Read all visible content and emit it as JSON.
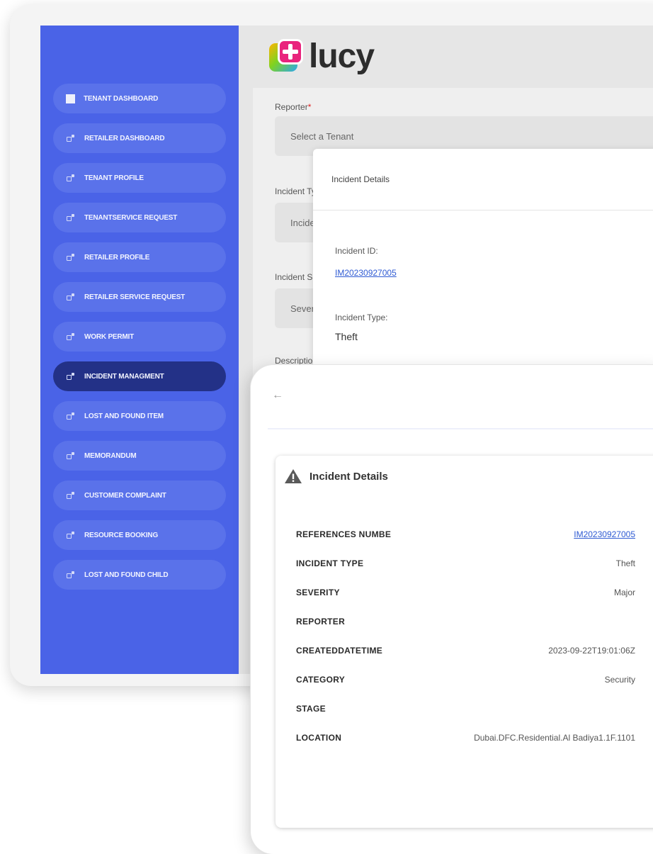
{
  "app": {
    "logo_text": "lucy"
  },
  "sidebar": {
    "items": [
      {
        "label": "TENANT DASHBOARD",
        "icon": "square-icon",
        "active": false
      },
      {
        "label": "RETAILER DASHBOARD",
        "icon": "module-icon",
        "active": false
      },
      {
        "label": "TENANT PROFILE",
        "icon": "module-icon",
        "active": false
      },
      {
        "label": "TENANTSERVICE REQUEST",
        "icon": "module-icon",
        "active": false
      },
      {
        "label": "RETAILER PROFILE",
        "icon": "module-icon",
        "active": false
      },
      {
        "label": "RETAILER SERVICE REQUEST",
        "icon": "module-icon",
        "active": false
      },
      {
        "label": "WORK PERMIT",
        "icon": "module-icon",
        "active": false
      },
      {
        "label": "INCIDENT MANAGMENT",
        "icon": "module-icon",
        "active": true
      },
      {
        "label": "LOST AND FOUND ITEM",
        "icon": "module-icon",
        "active": false
      },
      {
        "label": "MEMORANDUM",
        "icon": "module-icon",
        "active": false
      },
      {
        "label": "CUSTOMER COMPLAINT",
        "icon": "module-icon",
        "active": false
      },
      {
        "label": "RESOURCE BOOKING",
        "icon": "module-icon",
        "active": false
      },
      {
        "label": "LOST AND FOUND CHILD",
        "icon": "module-icon",
        "active": false
      }
    ],
    "colors": {
      "background": "#4a63e7",
      "item": "#5a72ea",
      "active": "#233187"
    }
  },
  "form": {
    "reporter_label": "Reporter",
    "required_mark": "*",
    "reporter_placeholder": "Select a Tenant",
    "incident_type_label": "Incident Ty",
    "incident_type_value": "Incider",
    "incident_severity_label": "Incident S",
    "severity_value": "Severi",
    "description_label": "Descriptio"
  },
  "middle_card": {
    "title": "Incident Details",
    "id_label": "Incident ID:",
    "id_value": "IM20230927005",
    "type_label": "Incident Type:",
    "type_value": "Theft"
  },
  "details": {
    "back_icon": "arrow-left-icon",
    "title": "Incident Details",
    "title_icon": "warning-icon",
    "rows": [
      {
        "key": "REFERENCES NUMBE",
        "value": "IM20230927005",
        "link": true
      },
      {
        "key": "INCIDENT TYPE",
        "value": "Theft",
        "link": false
      },
      {
        "key": "SEVERITY",
        "value": "Major",
        "link": false
      },
      {
        "key": "REPORTER",
        "value": "",
        "link": false
      },
      {
        "key": "CREATEDDATETIME",
        "value": "2023-09-22T19:01:06Z",
        "link": false
      },
      {
        "key": "CATEGORY",
        "value": "Security",
        "link": false
      },
      {
        "key": "STAGE",
        "value": "",
        "link": false
      },
      {
        "key": "LOCATION",
        "value": "Dubai.DFC.Residential.Al Badiya1.1F.1101",
        "link": false
      }
    ],
    "link_color": "#2f5bd3"
  }
}
